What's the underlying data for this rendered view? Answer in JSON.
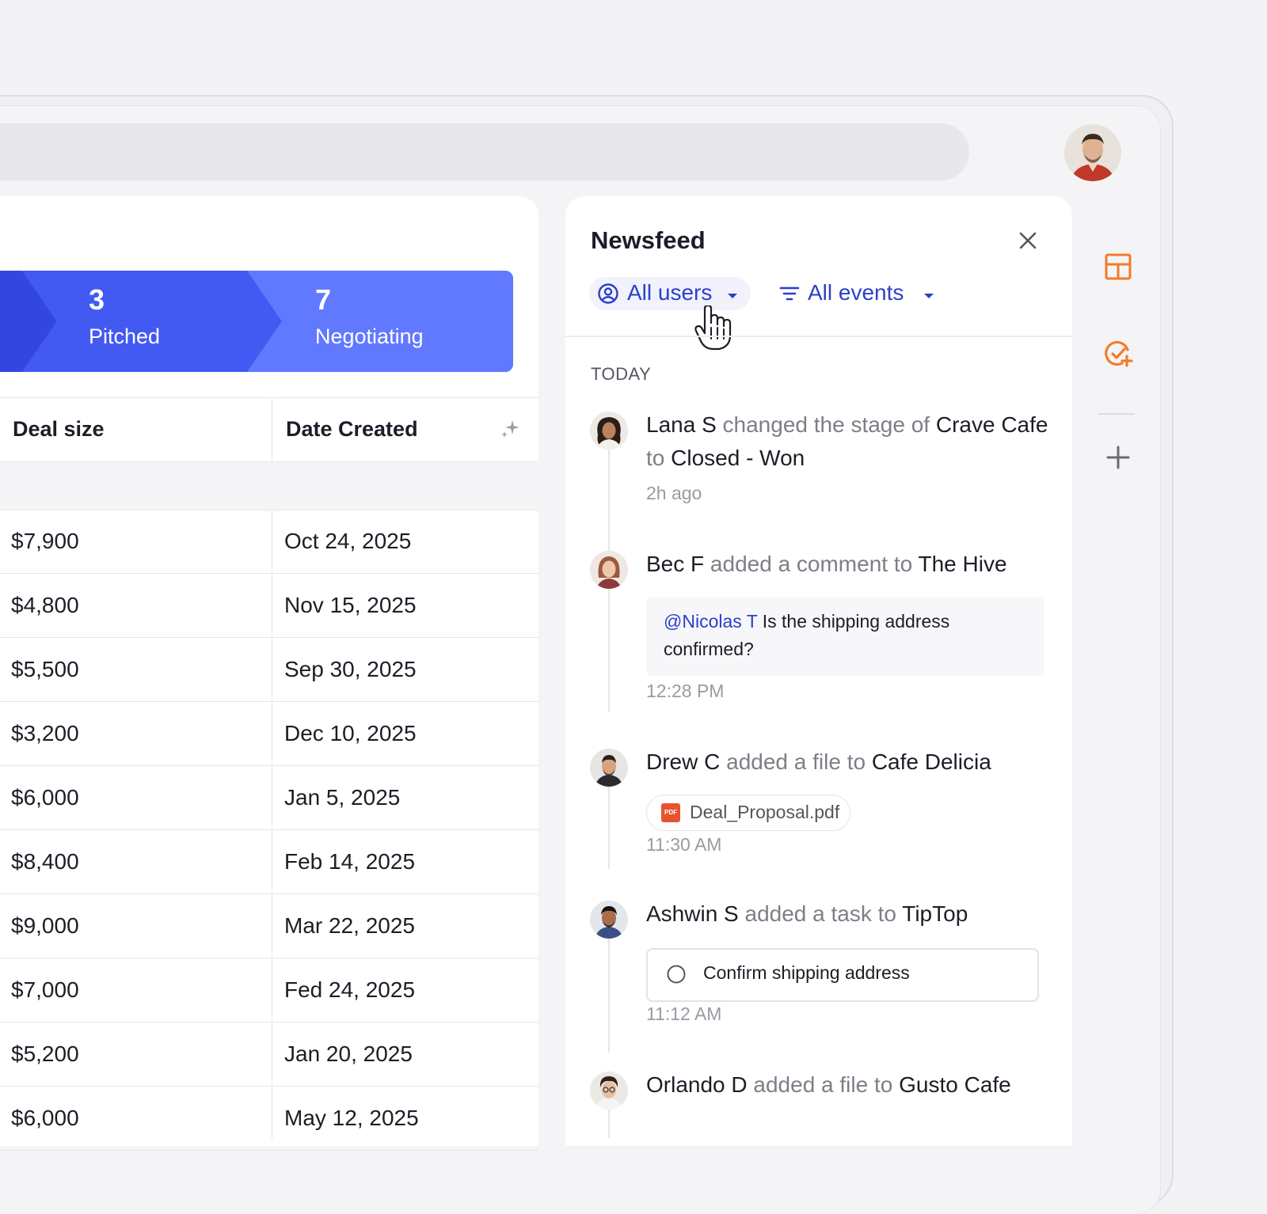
{
  "pipeline": [
    {
      "count": "3",
      "label": "Pitched",
      "color": "#3b55ee"
    },
    {
      "count": "7",
      "label": "Negotiating",
      "color": "#6079ff"
    }
  ],
  "table": {
    "columns": [
      "Deal size",
      "Date Created"
    ],
    "rows": [
      [
        "$7,900",
        "Oct 24, 2025"
      ],
      [
        "$4,800",
        "Nov 15, 2025"
      ],
      [
        "$5,500",
        "Sep 30, 2025"
      ],
      [
        "$3,200",
        "Dec 10, 2025"
      ],
      [
        "$6,000",
        "Jan 5, 2025"
      ],
      [
        "$8,400",
        "Feb 14, 2025"
      ],
      [
        "$9,000",
        "Mar 22, 2025"
      ],
      [
        "$7,000",
        "Fed 24, 2025"
      ],
      [
        "$5,200",
        "Jan 20, 2025"
      ],
      [
        "$6,000",
        "May 12, 2025"
      ]
    ]
  },
  "newsfeed": {
    "title": "Newsfeed",
    "filter_users": "All users",
    "filter_events": "All events",
    "section": "TODAY",
    "items": [
      {
        "user": "Lana S",
        "action": "changed the stage of",
        "target": "Crave Cafe",
        "action2": "to",
        "target2": "Closed - Won",
        "time": "2h ago"
      },
      {
        "user": "Bec F",
        "action": "added a comment to",
        "target": "The Hive",
        "mention": "@Nicolas T",
        "comment": "Is the shipping address confirmed?",
        "time": "12:28 PM"
      },
      {
        "user": "Drew C",
        "action": "added a file to",
        "target": "Cafe Delicia",
        "file_badge": "PDF",
        "file": "Deal_Proposal.pdf",
        "time": "11:30 AM"
      },
      {
        "user": "Ashwin S",
        "action": "added a task to",
        "target": "TipTop",
        "task": "Confirm shipping address",
        "time": "11:12 AM"
      },
      {
        "user": "Orlando D",
        "action": "added a file to",
        "target": "Gusto Cafe"
      }
    ]
  },
  "colors": {
    "accent": "#2a3fc9",
    "orange": "#f47a2a",
    "pdf": "#e8532f"
  },
  "icons": [
    "user-circle-icon",
    "chevron-down-icon",
    "filter-icon",
    "close-icon",
    "sparkle-icon",
    "layout-icon",
    "task-add-icon",
    "plus-icon",
    "pdf-icon",
    "checkbox-circle-icon",
    "hand-cursor-icon"
  ]
}
